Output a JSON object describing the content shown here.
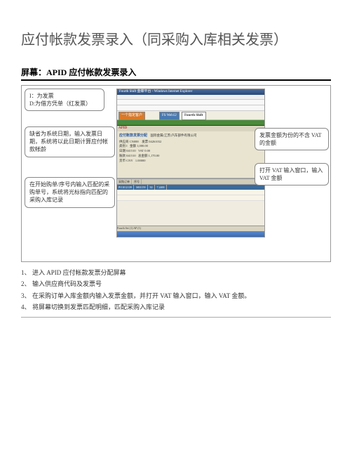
{
  "page": {
    "title": "应付帐款发票录入（同采购入库相关发票）",
    "section_header": "屏幕：APID 应付帐款发票录入"
  },
  "callouts": {
    "c1_line1": "I：为发票",
    "c1_line2": "D:为借方凭单（红发票）",
    "c2": "缺省为系统日期，输入发票日期，系统将以此日期计算应付帐款帐龄",
    "c3": "在开始购单/序号内输入匹配的采购单号，系统将光标指向匹配的采购入库记录",
    "c4": "发票金额为份的不含 VAT 的金额",
    "c5": "打开 VAT 输入窗口，输入 VAT 金额"
  },
  "screenshot": {
    "window_title": "Fourth Shift 金蝶平台 - Windows Internet Explorer",
    "tab_orange": "一个指定客户",
    "tab_blue": "FS Web12",
    "tab_fs": "Fourth Shift",
    "toolbar_label": "APID",
    "form_title": "应付账款发票分配",
    "company_name": "国际金属(江苏)汽车部件有限公司",
    "labels": {
      "vendor": "供应商",
      "invoice": "发票",
      "type": "类别",
      "date": "日期",
      "due": "账款",
      "amount": "金额",
      "currency": "货币",
      "vat": "VAT",
      "total": "总金额"
    },
    "values": {
      "vendor_code": "CN088",
      "invoice_no": "04261032",
      "type_code": "I",
      "date_1": "041510",
      "amount_1": "1000.00",
      "amount_2": "1,000.00",
      "vat_amt": "0.00",
      "total_amt": "1,170.00",
      "currency": "CNY",
      "rate": "1.00000"
    },
    "grid": {
      "po_label": "采购订单",
      "seq_label": "序号",
      "po_value_a": "PO1012139",
      "po_value_b": "M01159",
      "qty": "50",
      "price": "7.2400"
    },
    "status_app": "Fourth Set (1) AP (1)"
  },
  "steps": {
    "s1": "进入 APID 应付帐款发票分配屏幕",
    "s2": "输入供应商代码及发票号",
    "s3": "在采购订单入库金额内输入发票金额，并打开 VAT 输入窗口，输入 VAT 金额。",
    "s4": "将屏幕切换到发票匹配明细，匹配采购入库记录"
  }
}
